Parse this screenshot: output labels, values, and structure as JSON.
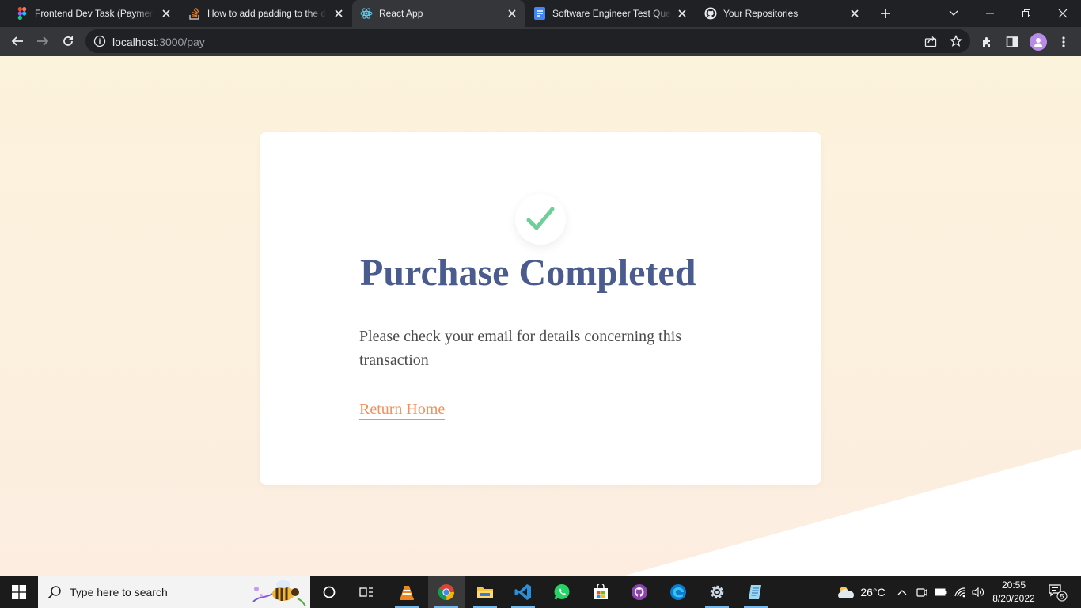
{
  "browser": {
    "tabs": [
      {
        "title": "Frontend Dev Task (Payment",
        "icon": "figma-icon"
      },
      {
        "title": "How to add padding to the d",
        "icon": "stackoverflow-icon"
      },
      {
        "title": "React App",
        "icon": "react-icon",
        "active": true
      },
      {
        "title": "Software Engineer Test Ques",
        "icon": "google-docs-icon"
      },
      {
        "title": "Your Repositories",
        "icon": "github-icon"
      }
    ],
    "url_host": "localhost",
    "url_rest": ":3000/pay"
  },
  "page": {
    "title": "Purchase Completed",
    "message": "Please check your email for details concerning this transaction",
    "link": "Return Home",
    "accent_color": "#f0925d",
    "title_color": "#4a5b8f",
    "check_color": "#6fcf97"
  },
  "taskbar": {
    "search_placeholder": "Type here to search",
    "apps": [
      "task-view-icon",
      "vlc-icon",
      "chrome-icon",
      "file-explorer-icon",
      "vscode-icon",
      "whatsapp-icon",
      "microsoft-store-icon",
      "github-desktop-icon",
      "edge-icon",
      "settings-icon",
      "notepad-icon"
    ],
    "weather": "26°C",
    "time": "20:55",
    "date": "8/20/2022",
    "notification_count": "5"
  }
}
